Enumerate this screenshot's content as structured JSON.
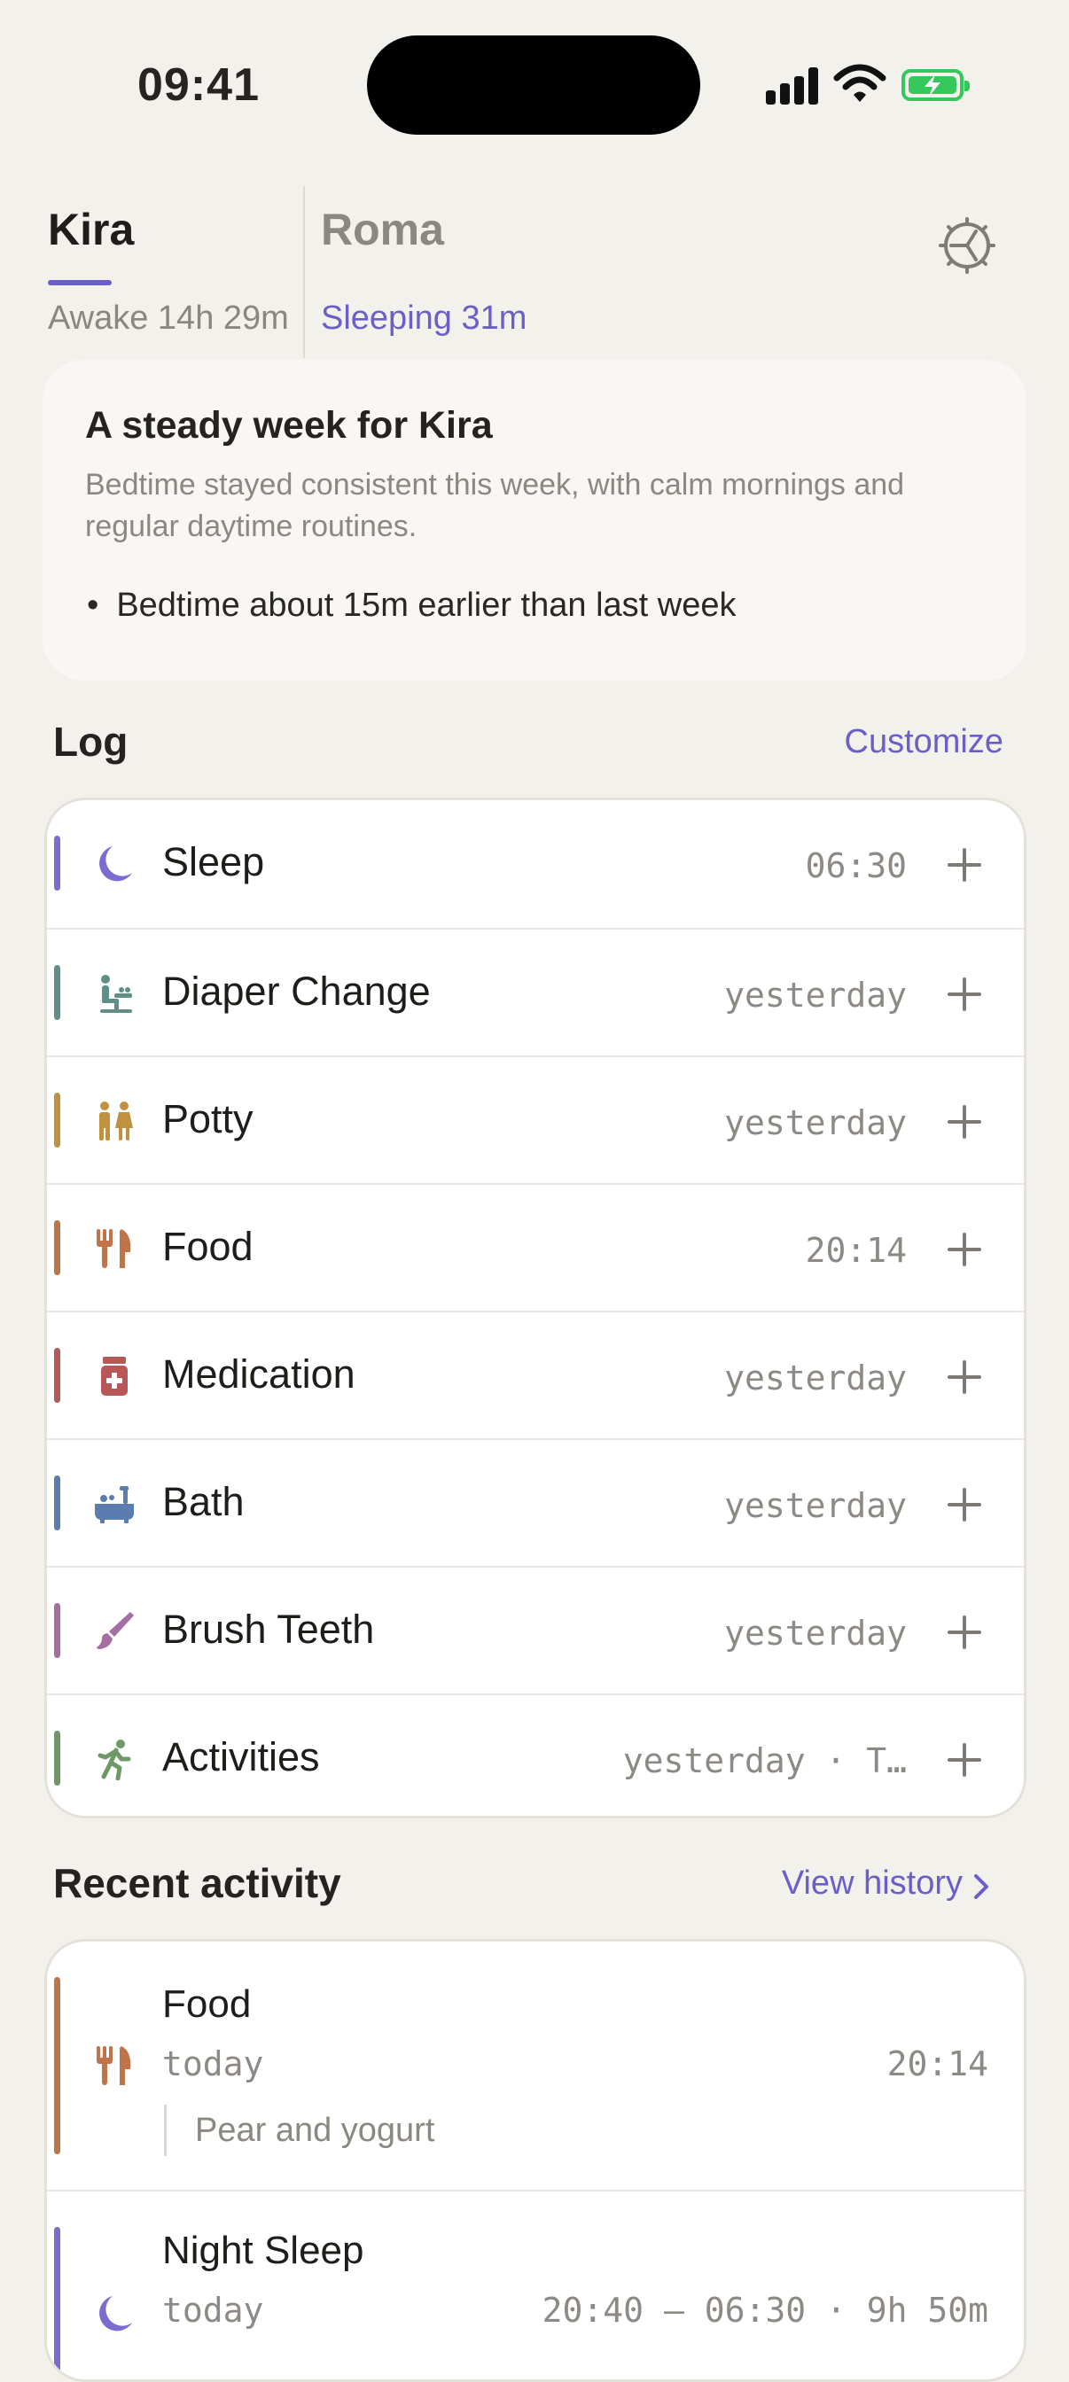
{
  "status_bar": {
    "time": "09:41"
  },
  "profiles": [
    {
      "name": "Kira",
      "state": "Awake 14h 29m"
    },
    {
      "name": "Roma",
      "state": "Sleeping 31m"
    }
  ],
  "summary": {
    "title": "A steady week for Kira",
    "description": "Bedtime stayed consistent this week, with calm mornings and regular daytime routines.",
    "bullet": "Bedtime about 15m earlier than last week"
  },
  "log": {
    "title": "Log",
    "customize_label": "Customize",
    "items": [
      {
        "label": "Sleep",
        "last": "06:30",
        "icon": "moon-icon",
        "color": "#7b6cd1"
      },
      {
        "label": "Diaper Change",
        "last": "yesterday",
        "icon": "changing-table-icon",
        "color": "#5f8f86"
      },
      {
        "label": "Potty",
        "last": "yesterday",
        "icon": "restroom-icon",
        "color": "#c0913f"
      },
      {
        "label": "Food",
        "last": "20:14",
        "icon": "fork-knife-icon",
        "color": "#c0744a"
      },
      {
        "label": "Medication",
        "last": "yesterday",
        "icon": "medicine-bottle-icon",
        "color": "#b85757"
      },
      {
        "label": "Bath",
        "last": "yesterday",
        "icon": "bathtub-icon",
        "color": "#5a7cae"
      },
      {
        "label": "Brush Teeth",
        "last": "yesterday",
        "icon": "brush-icon",
        "color": "#a66fa3"
      },
      {
        "label": "Activities",
        "last": "yesterday · T…",
        "icon": "running-person-icon",
        "color": "#6f9866"
      }
    ]
  },
  "recent": {
    "title": "Recent activity",
    "view_history_label": "View history",
    "entries": [
      {
        "title": "Food",
        "day": "today",
        "time": "20:14",
        "note": "Pear and yogurt",
        "icon": "fork-knife-icon",
        "color": "#c0744a"
      },
      {
        "title": "Night Sleep",
        "day": "today",
        "time": "20:40 – 06:30 · 9h 50m",
        "icon": "moon-icon",
        "color": "#7b6cd1"
      }
    ]
  }
}
